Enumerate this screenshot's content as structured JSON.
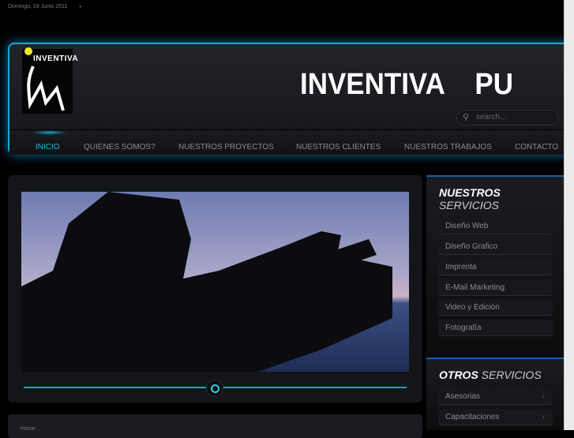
{
  "date": "Domingo, 19 Junio 2011",
  "header": {
    "logo_text": "INVENTIVA",
    "banner": "INVENTIVA    PU",
    "search_placeholder": "search..."
  },
  "nav": [
    "INICIO",
    "QUIENES SOMOS?",
    "NUESTROS PROYECTOS",
    "NUESTROS CLIENTES",
    "NUESTROS TRABAJOS",
    "CONTACTO"
  ],
  "breadcrumb": "Home",
  "nuestros": {
    "title_bold": "NUESTROS",
    "title_light": "SERVICIOS",
    "items": [
      "Diseño Web",
      "Diseño Grafico",
      "Imprenta",
      "E-Mail Marketing",
      "Video y Edición",
      "Fotografía"
    ]
  },
  "otros": {
    "title_bold": "OTROS",
    "title_light": "SERVICIOS",
    "items": [
      "Asesorias",
      "Capacitaciones"
    ]
  },
  "colors": {
    "accent": "#1aa6d6",
    "active_nav": "#26b4e6"
  }
}
